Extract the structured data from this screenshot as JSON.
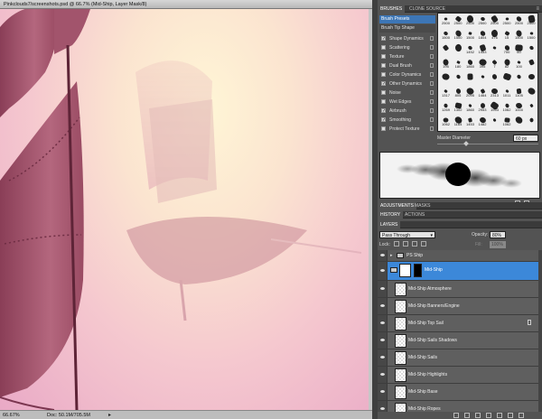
{
  "document": {
    "tab_title": "Pinkclouds7/screenshots.psd @ 66.7% (Mid-Ship, Layer Mask/8)",
    "close_glyph": "×",
    "zoom": "66.67%",
    "doc_size": "Doc: 50.1M/705.5M",
    "status_arrow": "▸"
  },
  "panels": {
    "brushes_tab": "BRUSHES",
    "clone_source_tab": "CLONE SOURCE",
    "adjustments_tab": "ADJUSTMENTS",
    "masks_tab": "MASKS",
    "history_tab": "HISTORY",
    "actions_tab": "ACTIONS",
    "layers_tab": "LAYERS",
    "collapse_glyph": "≡"
  },
  "brushes": {
    "presets_label": "Brush Presets",
    "tip_shape_label": "Brush Tip Shape",
    "options": [
      {
        "label": "Shape Dynamics",
        "checked": true
      },
      {
        "label": "Scattering",
        "checked": false
      },
      {
        "label": "Texture",
        "checked": false
      },
      {
        "label": "Dual Brush",
        "checked": false
      },
      {
        "label": "Color Dynamics",
        "checked": false
      },
      {
        "label": "Other Dynamics",
        "checked": true
      },
      {
        "label": "Noise",
        "checked": false
      },
      {
        "label": "Wet Edges",
        "checked": false
      },
      {
        "label": "Airbrush",
        "checked": true
      },
      {
        "label": "Smoothing",
        "checked": true
      },
      {
        "label": "Protect Texture",
        "checked": false
      }
    ],
    "sizes": [
      "2500",
      "2500",
      "2500",
      "2500",
      "2500",
      "2500",
      "2500",
      "2500",
      "1500",
      "1500",
      "1500",
      "1804",
      "476",
      "15",
      "1500",
      "1500",
      "",
      "",
      "1452",
      "1453",
      "",
      "700",
      "60",
      "",
      "195",
      "180",
      "1860",
      "395",
      "7",
      "82",
      "100",
      "",
      "",
      "",
      "",
      "",
      "",
      "",
      "",
      "",
      "1317",
      "805",
      "2095",
      "1464",
      "2313",
      "1011",
      "1105",
      "",
      "1269",
      "1302",
      "1860",
      "2953",
      "1953",
      "1062",
      "1000",
      "",
      "1062",
      "1164",
      "1453",
      "1482",
      "",
      "1062",
      "",
      ""
    ],
    "master_diameter_label": "Master Diameter",
    "master_diameter_value": "60 px"
  },
  "layers": {
    "blend_mode": "Pass Through",
    "opacity_label": "Opacity:",
    "opacity_value": "80%",
    "lock_label": "Lock:",
    "fill_label": "Fill:",
    "fill_value": "100%",
    "group_name": "PS Ship",
    "selected_layer": "Mid-Ship",
    "items": [
      {
        "name": "Mid-Ship Atmosphere",
        "locked": false
      },
      {
        "name": "Mid-Ship Banners/Engine",
        "locked": false
      },
      {
        "name": "Mid-Ship Top Sail",
        "locked": true
      },
      {
        "name": "Mid-Ship Sails Shadows",
        "locked": false
      },
      {
        "name": "Mid-Ship Sails",
        "locked": false
      },
      {
        "name": "Mid-Ship Highlights",
        "locked": false
      },
      {
        "name": "Mid-Ship Base",
        "locked": false
      },
      {
        "name": "Mid-Ship Ropes",
        "locked": false
      }
    ]
  },
  "colors": {
    "accent": "#3c88d9",
    "panel_bg": "#535353"
  }
}
